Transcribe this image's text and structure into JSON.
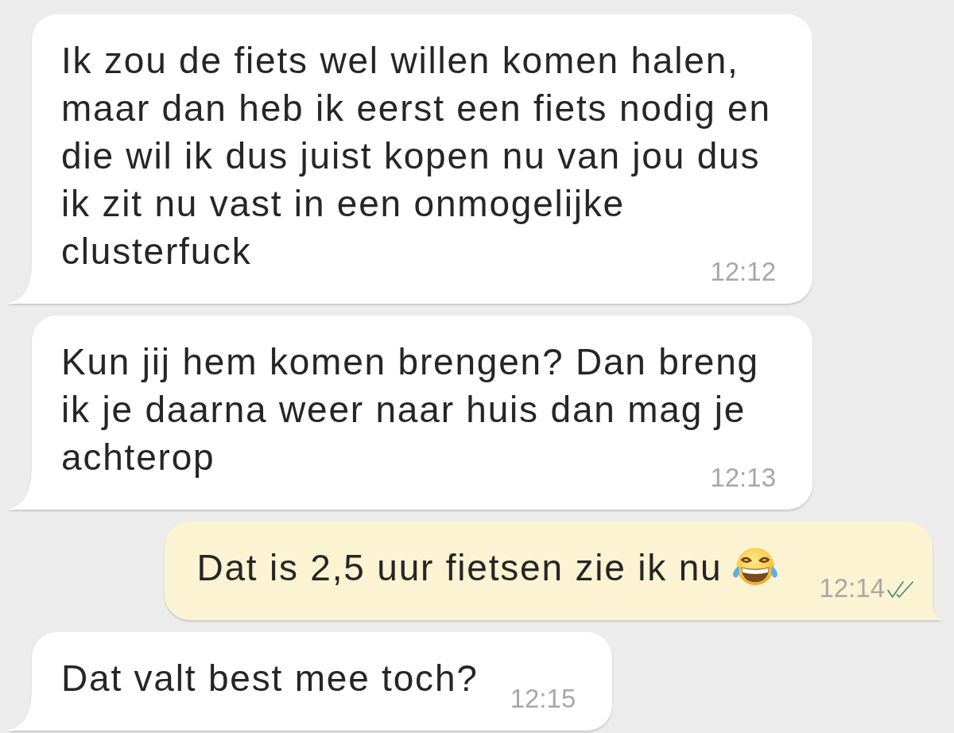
{
  "messages": [
    {
      "kind": "incoming",
      "text": "Ik zou de fiets wel willen komen halen, maar dan heb ik eerst een fiets nodig en die wil ik dus juist kopen nu van jou dus ik zit nu vast in een onmogelijke clusterfuck",
      "emoji": false,
      "time": "12:12"
    },
    {
      "kind": "incoming",
      "text": "Kun jij hem komen brengen? Dan breng ik je daarna weer naar huis dan mag je achterop",
      "emoji": false,
      "time": "12:13"
    },
    {
      "kind": "outgoing",
      "text": "Dat is 2,5 uur fietsen zie ik nu",
      "emoji": true,
      "time": "12:14",
      "delivered": true
    },
    {
      "kind": "incoming",
      "text": "Dat valt best mee toch?",
      "emoji": false,
      "time": "12:15"
    }
  ]
}
